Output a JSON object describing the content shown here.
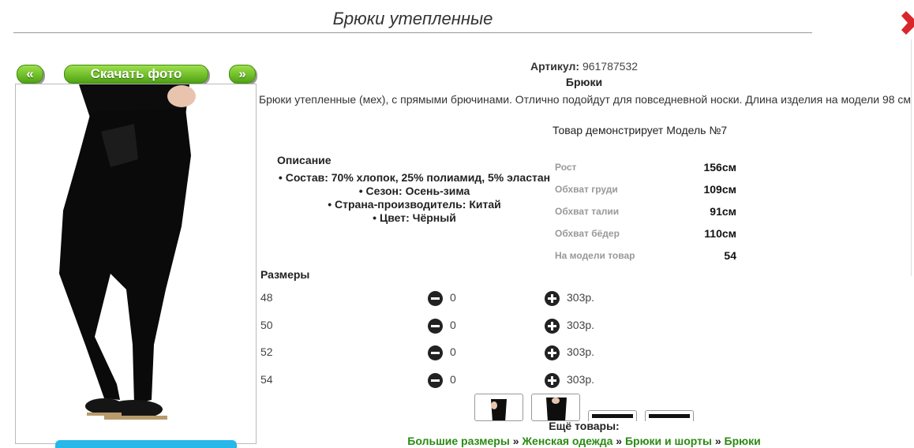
{
  "page": {
    "title": "Брюки утепленные"
  },
  "photo_nav": {
    "prev_label": "«",
    "download_label": "Скачать фото",
    "next_label": "»"
  },
  "product": {
    "article_label": "Артикул:",
    "article_value": "961787532",
    "type": "Брюки",
    "description": "Брюки утепленные (мех), с прямыми брючинами. Отлично подойдут для повседневной носки. Длина изделия на модели 98 см",
    "model_note": "Товар демонстрирует Модель №7"
  },
  "specs": {
    "heading": "Описание",
    "items": [
      "Состав: 70% хлопок, 25% полиамид, 5% эластан",
      "Сезон: Осень-зима",
      "Страна-производитель: Китай",
      "Цвет: Чёрный"
    ]
  },
  "measurements": [
    {
      "label": "Рост",
      "value": "156см"
    },
    {
      "label": "Обхват груди",
      "value": "109см"
    },
    {
      "label": "Обхват талии",
      "value": "91см"
    },
    {
      "label": "Обхват бёдер",
      "value": "110см"
    },
    {
      "label": "На модели товар",
      "value": "54"
    }
  ],
  "sizes": {
    "heading": "Размеры",
    "rows": [
      {
        "size": "48",
        "qty": "0",
        "price": "303р."
      },
      {
        "size": "50",
        "qty": "0",
        "price": "303р."
      },
      {
        "size": "52",
        "qty": "0",
        "price": "303р."
      },
      {
        "size": "54",
        "qty": "0",
        "price": "303р."
      }
    ]
  },
  "more": {
    "label": "Ещё товары:",
    "crumbs": [
      "Большие размеры",
      "Женская одежда",
      "Брюки и шорты",
      "Брюки"
    ],
    "separator": "»"
  },
  "colors": {
    "accent_green": "#4fa214",
    "link_green": "#2a8a13",
    "close_red": "#d9262b",
    "blue_bar": "#25b8e8"
  }
}
